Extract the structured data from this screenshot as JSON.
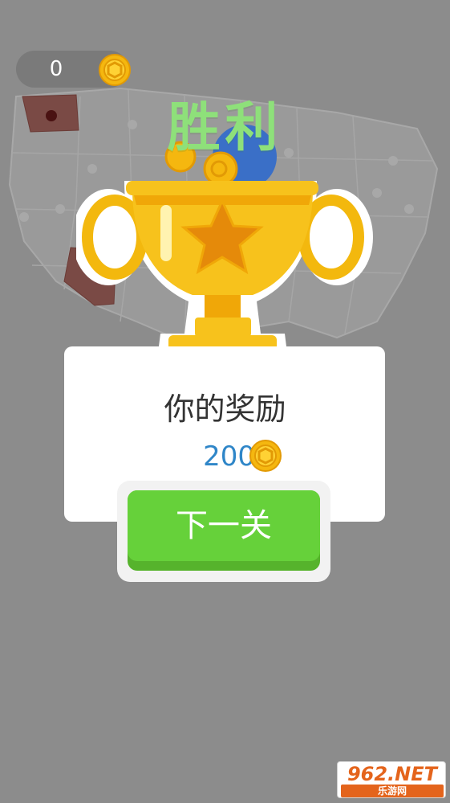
{
  "coin_counter": {
    "value": "0",
    "icon": "coin-icon"
  },
  "victory": {
    "title": "胜利"
  },
  "trophy": {
    "icon": "trophy-icon",
    "star": "star-icon"
  },
  "reward": {
    "title": "你的奖励",
    "amount": "200",
    "icon": "coin-icon"
  },
  "next_button": {
    "label": "下一关"
  },
  "watermark": {
    "top": "962.NET",
    "bottom": "乐游网"
  },
  "colors": {
    "background": "#8c8c8c",
    "victory_text": "#8ee07a",
    "button_green": "#66d13a",
    "amount_blue": "#2f86c8",
    "coin_gold": "#f5b70f",
    "watermark_orange": "#e4641c"
  }
}
